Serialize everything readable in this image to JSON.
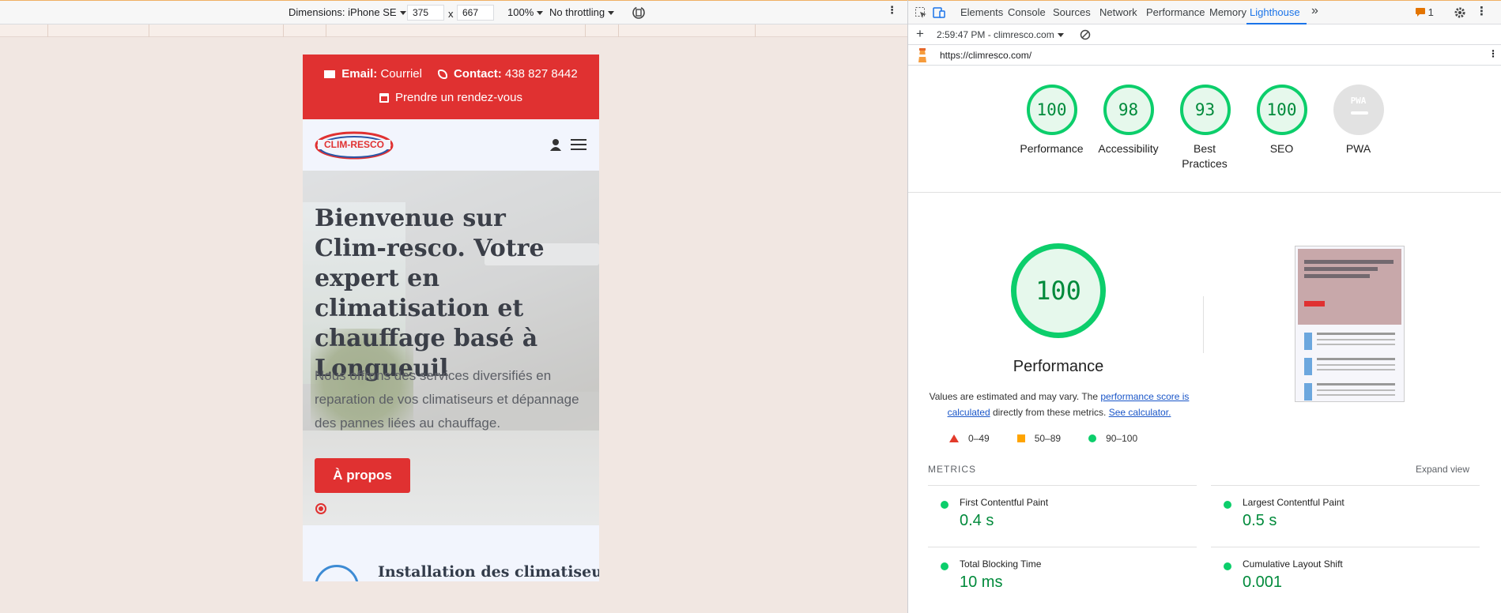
{
  "device_toolbar": {
    "dimensions_label": "Dimensions: iPhone SE",
    "width": "375",
    "x_sep": "x",
    "height": "667",
    "zoom": "100%",
    "throttling": "No throttling"
  },
  "site": {
    "email_label": "Email:",
    "email_value": "Courriel",
    "contact_label": "Contact:",
    "contact_value": "438 827 8442",
    "appointment": "Prendre un rendez-vous",
    "logo_text": "CLIM-RESCO",
    "hero_title": "Bienvenue sur Clim-resco. Votre expert en climatisation et chauffage basé à Longueuil",
    "hero_text": "Nous offrons des services diversifiés en reparation de vos climatiseurs et dépannage des pannes liées au chauffage.",
    "hero_button": "À propos",
    "service_title": "Installation des climatiseurs"
  },
  "devtools": {
    "tabs": [
      "Elements",
      "Console",
      "Sources",
      "Network",
      "Performance",
      "Memory",
      "Lighthouse"
    ],
    "more": "»",
    "issues_count": "1",
    "report_time": "2:59:47 PM - climresco.com",
    "url": "https://climresco.com/"
  },
  "lighthouse": {
    "scores": [
      {
        "label": "Performance",
        "value": "100"
      },
      {
        "label": "Accessibility",
        "value": "98"
      },
      {
        "label": "Best Practices",
        "value": "93"
      },
      {
        "label": "SEO",
        "value": "100"
      },
      {
        "label": "PWA",
        "value": "PWA"
      }
    ],
    "main_score": "100",
    "main_label": "Performance",
    "desc_prefix": "Values are estimated and may vary. The",
    "desc_link1": "performance score is calculated",
    "desc_mid": "directly from these metrics.",
    "desc_link2": "See calculator.",
    "legend": [
      "0–49",
      "50–89",
      "90–100"
    ],
    "metrics_heading": "METRICS",
    "expand_view": "Expand view",
    "metrics": [
      {
        "name": "First Contentful Paint",
        "value": "0.4 s"
      },
      {
        "name": "Largest Contentful Paint",
        "value": "0.5 s"
      },
      {
        "name": "Total Blocking Time",
        "value": "10 ms"
      },
      {
        "name": "Cumulative Layout Shift",
        "value": "0.001"
      }
    ]
  },
  "colors": {
    "brand_red": "#e03131",
    "pass_green": "#0cce6b",
    "devtools_blue": "#1a73e8"
  }
}
